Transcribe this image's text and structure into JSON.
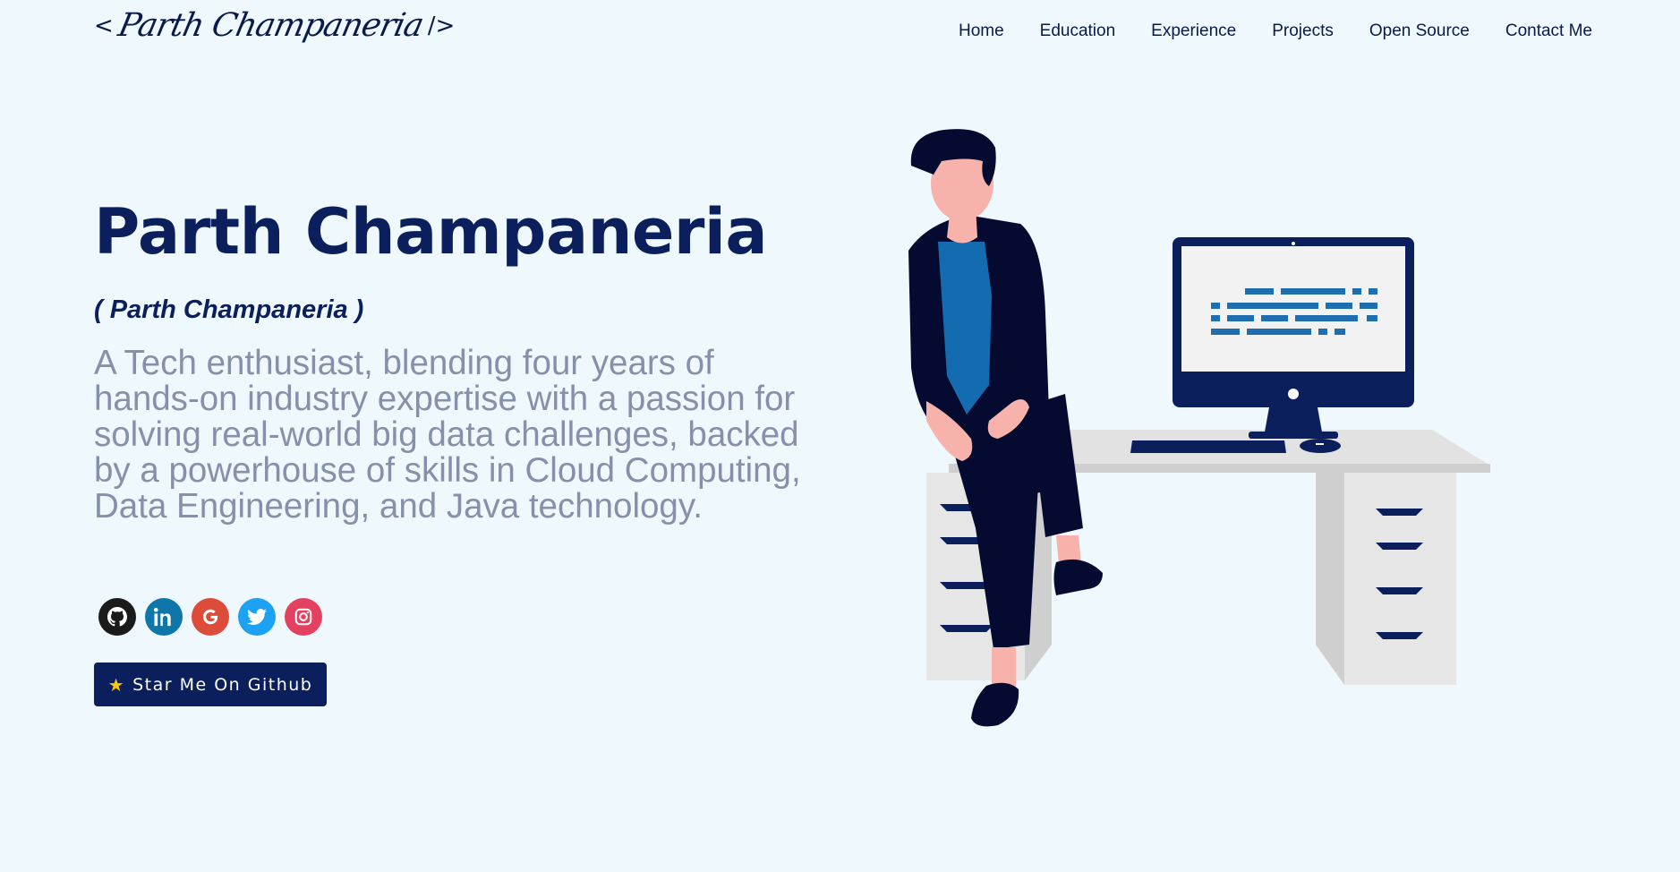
{
  "header": {
    "logo": {
      "open": "<",
      "signature": "Parth Champaneria",
      "close": "/>"
    },
    "nav": [
      "Home",
      "Education",
      "Experience",
      "Projects",
      "Open Source",
      "Contact Me"
    ]
  },
  "hero": {
    "name": "Parth Champaneria",
    "subtitle": "( Parth Champaneria )",
    "bio": "A Tech enthusiast, blending four years of hands-on industry expertise with a passion for solving real-world big data challenges, backed by a powerhouse of skills in Cloud Computing, Data Engineering, and Java technology.",
    "socials": [
      {
        "icon": "github-icon",
        "color": "#1b1b1b"
      },
      {
        "icon": "linkedin-icon",
        "color": "#0e76a8"
      },
      {
        "icon": "google-icon",
        "color": "#dd4b39"
      },
      {
        "icon": "twitter-icon",
        "color": "#1da1f2"
      },
      {
        "icon": "instagram-icon",
        "color": "#e4405f"
      }
    ],
    "button": {
      "icon": "star-icon",
      "label": "Star Me On Github"
    }
  },
  "colors": {
    "background": "#eef8fd",
    "primary": "#0a1f5c",
    "muted_text": "#8690aa"
  }
}
